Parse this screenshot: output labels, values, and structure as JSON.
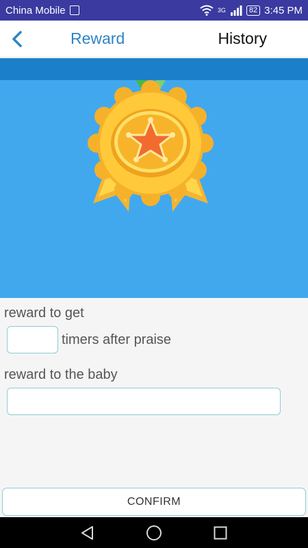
{
  "status_bar": {
    "carrier": "China Mobile",
    "network": "3G",
    "battery": "82",
    "time": "3:45 PM"
  },
  "header": {
    "title": "Reward",
    "history_label": "History"
  },
  "form": {
    "reward_to_get_label": "reward to get",
    "times_value": "",
    "times_suffix": "timers after praise",
    "reward_baby_label": "reward to the baby",
    "reward_baby_value": ""
  },
  "confirm_label": "CONFIRM",
  "icons": {
    "back": "back-arrow-icon",
    "medal": "medal-icon",
    "wifi": "wifi-icon",
    "signal": "signal-icon",
    "nav_back": "nav-back-icon",
    "nav_home": "nav-home-icon",
    "nav_recents": "nav-recents-icon"
  },
  "colors": {
    "accent": "#2e84c6",
    "banner": "#42a8ee",
    "banner_strip": "#1b80c9",
    "status_bar": "#3a3aa0",
    "input_border": "#8ccbd5"
  }
}
